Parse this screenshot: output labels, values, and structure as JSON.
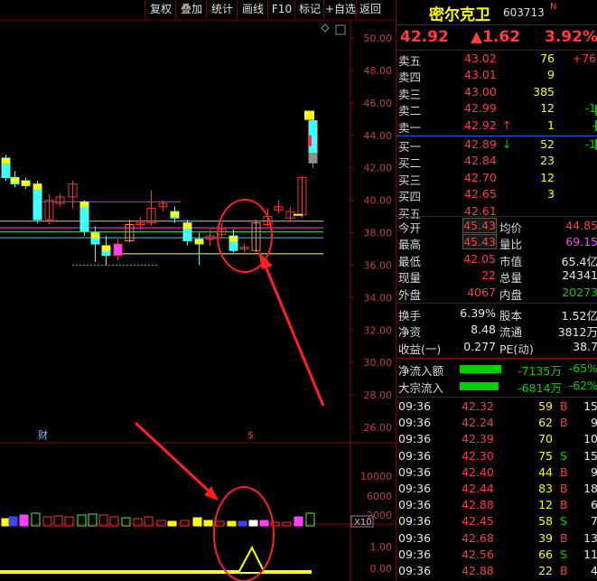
{
  "toolbar": {
    "items": [
      "复权",
      "叠加",
      "统计",
      "画线",
      "F10",
      "标记",
      "+自选",
      "返回"
    ]
  },
  "chart": {
    "price_axis": [
      "50.00",
      "48.00",
      "46.00",
      "44.00",
      "42.00",
      "40.00",
      "38.00",
      "36.00",
      "34.00",
      "32.00",
      "30.00",
      "28.00",
      "26.00"
    ],
    "volume_axis": [
      "10000",
      "6000",
      "2000"
    ],
    "volume_unit": "X10",
    "indicator_axis": [
      "1.00",
      "0.00"
    ],
    "markers": {
      "cai": "财",
      "s": "$"
    }
  },
  "stock": {
    "name": "密尔克卫",
    "code": "603713",
    "code_suffix": "N",
    "price": "42.92",
    "change": "▲1.62",
    "change_pct": "3.92%"
  },
  "order_book": {
    "sell": [
      {
        "label": "卖五",
        "price": "43.02",
        "vol": "76",
        "delta": "+76"
      },
      {
        "label": "卖四",
        "price": "43.01",
        "vol": "9",
        "delta": ""
      },
      {
        "label": "卖三",
        "price": "43.00",
        "vol": "385",
        "delta": ""
      },
      {
        "label": "卖二",
        "price": "42.99",
        "vol": "12",
        "delta": "-1"
      },
      {
        "label": "卖一",
        "price": "42.92",
        "vol": "1",
        "delta": "-",
        "arrow": "↑"
      }
    ],
    "buy": [
      {
        "label": "买一",
        "price": "42.89",
        "vol": "52",
        "delta": "-1",
        "arrow": "↓"
      },
      {
        "label": "买二",
        "price": "42.84",
        "vol": "23",
        "delta": ""
      },
      {
        "label": "买三",
        "price": "42.70",
        "vol": "12",
        "delta": ""
      },
      {
        "label": "买四",
        "price": "42.65",
        "vol": "3",
        "delta": ""
      },
      {
        "label": "买五",
        "price": "42.61",
        "vol": "",
        "delta": ""
      }
    ]
  },
  "quote": [
    {
      "l1": "今开",
      "v1": "45.43",
      "l2": "均价",
      "v2": "44.85"
    },
    {
      "l1": "最高",
      "v1": "45.43",
      "l2": "量比",
      "v2": "69.15"
    },
    {
      "l1": "最低",
      "v1": "42.05",
      "l2": "市值",
      "v2": "65.4亿"
    },
    {
      "l1": "现量",
      "v1": "22",
      "l2": "总量",
      "v2": "24341"
    },
    {
      "l1": "外盘",
      "v1": "4067",
      "l2": "内盘",
      "v2": "20273"
    }
  ],
  "stats": [
    {
      "l1": "换手",
      "v1": "6.39%",
      "l2": "股本",
      "v2": "1.52亿"
    },
    {
      "l1": "净资",
      "v1": "8.48",
      "l2": "流通",
      "v2": "3812万"
    },
    {
      "l1": "收益(一)",
      "v1": "0.277",
      "l2": "PE(动)",
      "v2": "38.7"
    }
  ],
  "flow": [
    {
      "label": "净流入额",
      "value": "-7135万",
      "pct": "-65%",
      "bar": 0.65
    },
    {
      "label": "大宗流入",
      "value": "-6814万",
      "pct": "-62%",
      "bar": 0.62
    }
  ],
  "trades": [
    {
      "time": "09:36",
      "price": "42.32",
      "vol": "59",
      "side": "B",
      "n": "15"
    },
    {
      "time": "09:36",
      "price": "42.24",
      "vol": "62",
      "side": "B",
      "n": "9"
    },
    {
      "time": "09:36",
      "price": "42.39",
      "vol": "70",
      "side": "",
      "n": "10"
    },
    {
      "time": "09:36",
      "price": "42.30",
      "vol": "75",
      "side": "S",
      "n": "15"
    },
    {
      "time": "09:36",
      "price": "42.40",
      "vol": "44",
      "side": "B",
      "n": "9"
    },
    {
      "time": "09:36",
      "price": "42.44",
      "vol": "83",
      "side": "B",
      "n": "18"
    },
    {
      "time": "09:36",
      "price": "42.88",
      "vol": "12",
      "side": "B",
      "n": "6"
    },
    {
      "time": "09:36",
      "price": "42.45",
      "vol": "58",
      "side": "S",
      "n": "7"
    },
    {
      "time": "09:36",
      "price": "42.68",
      "vol": "39",
      "side": "B",
      "n": "13"
    },
    {
      "time": "09:36",
      "price": "42.56",
      "vol": "66",
      "side": "S",
      "n": "11"
    },
    {
      "time": "09:36",
      "price": "42.88",
      "vol": "22",
      "side": "B",
      "n": "4"
    }
  ]
}
